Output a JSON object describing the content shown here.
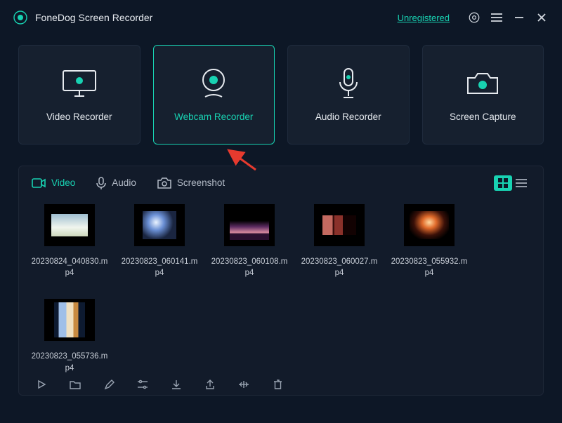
{
  "app": {
    "title": "FoneDog Screen Recorder"
  },
  "titlebar": {
    "unregistered": "Unregistered"
  },
  "modes": {
    "video": {
      "label": "Video Recorder"
    },
    "webcam": {
      "label": "Webcam Recorder"
    },
    "audio": {
      "label": "Audio Recorder"
    },
    "capture": {
      "label": "Screen Capture"
    },
    "selected": "webcam"
  },
  "gallery": {
    "tabs": {
      "video": "Video",
      "audio": "Audio",
      "screenshot": "Screenshot"
    },
    "active_tab": "video",
    "view": "grid",
    "items": [
      {
        "label": "20230824_040830.mp4"
      },
      {
        "label": "20230823_060141.mp4"
      },
      {
        "label": "20230823_060108.mp4"
      },
      {
        "label": "20230823_060027.mp4"
      },
      {
        "label": "20230823_055932.mp4"
      },
      {
        "label": "20230823_055736.mp4"
      }
    ]
  },
  "colors": {
    "accent": "#18d2b2",
    "bg": "#0d1726",
    "panel": "#121b2a"
  }
}
